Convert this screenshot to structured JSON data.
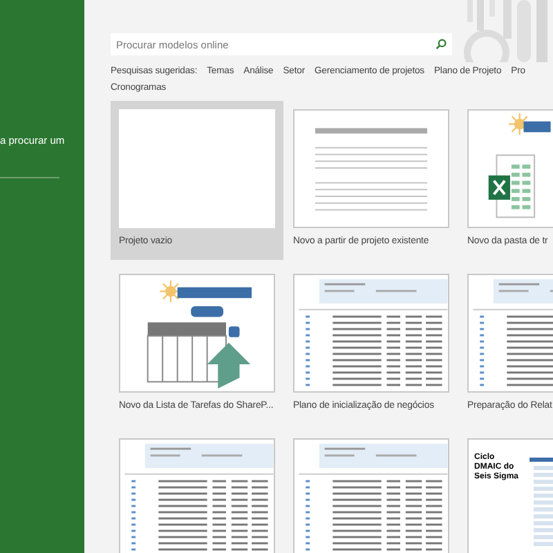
{
  "sidebar": {
    "text": "a procurar um"
  },
  "search": {
    "placeholder": "Procurar modelos online"
  },
  "suggested_searches": {
    "label": "Pesquisas sugeridas:",
    "rows": [
      [
        "Temas",
        "Análise",
        "Setor",
        "Gerenciamento de projetos",
        "Plano de Projeto",
        "Pro"
      ],
      [
        "Cronogramas"
      ]
    ]
  },
  "templates": [
    {
      "name": "Projeto vazio",
      "selected": true,
      "kind": "blank"
    },
    {
      "name": "Novo a partir de projeto existente",
      "selected": false,
      "kind": "lines"
    },
    {
      "name": "Novo da pasta de tr",
      "selected": false,
      "kind": "excel"
    },
    {
      "name": "Novo da Lista de Tarefas do ShareP...",
      "selected": false,
      "kind": "sharepoint"
    },
    {
      "name": "Plano de inicialização de negócios",
      "selected": false,
      "kind": "gantt"
    },
    {
      "name": "Preparação do Relat",
      "selected": false,
      "kind": "gantt"
    },
    {
      "selected": false,
      "kind": "gantt"
    },
    {
      "selected": false,
      "kind": "gantt"
    },
    {
      "selected": false,
      "kind": "dmaic",
      "preview_title": "Ciclo DMAIC do Seis Sigma"
    }
  ]
}
